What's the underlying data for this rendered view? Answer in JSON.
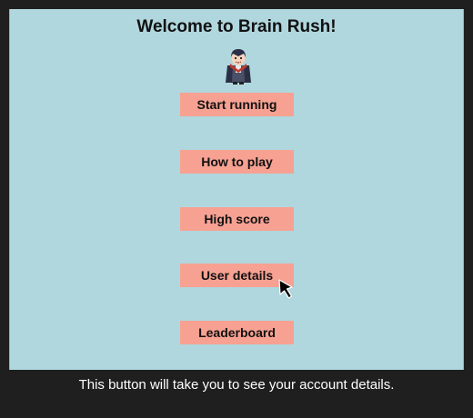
{
  "game": {
    "title": "Welcome to Brain Rush!",
    "mascot_icon": "vampire-icon",
    "menu": [
      {
        "label": "Start running"
      },
      {
        "label": "How to play"
      },
      {
        "label": "High score"
      },
      {
        "label": "User details"
      },
      {
        "label": "Leaderboard"
      }
    ],
    "hovered_item": "User details"
  },
  "caption": "This button will take you to see your account details.",
  "colors": {
    "page_background": "#1f1f1f",
    "panel_background": "#b0d6de",
    "button_background": "#f7a192",
    "button_text": "#111111",
    "caption_text": "#ffffff"
  }
}
